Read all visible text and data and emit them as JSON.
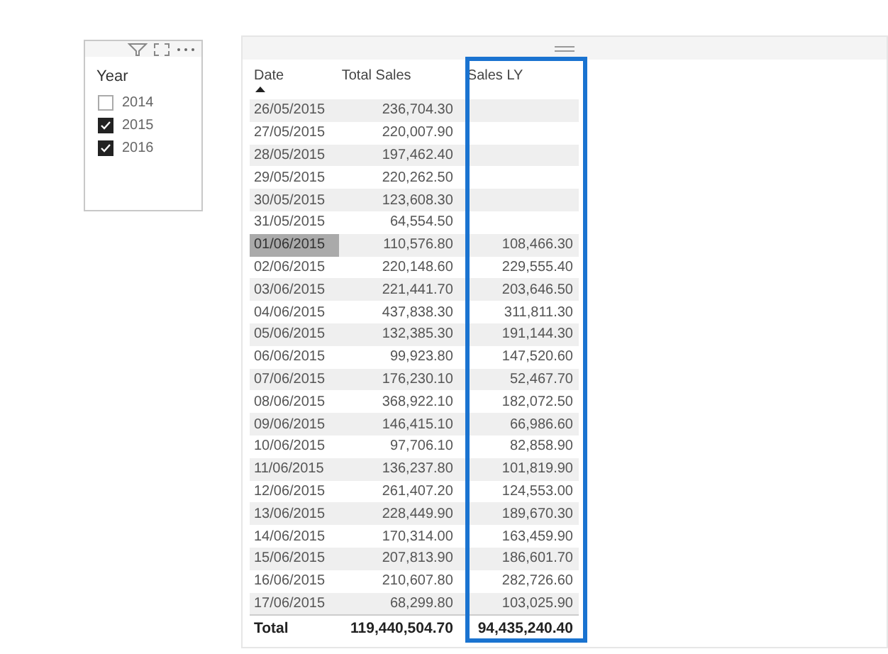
{
  "slicer": {
    "title": "Year",
    "items": [
      {
        "label": "2014",
        "checked": false
      },
      {
        "label": "2015",
        "checked": true
      },
      {
        "label": "2016",
        "checked": true
      }
    ]
  },
  "table": {
    "columns": [
      {
        "label": "Date",
        "highlighted": false
      },
      {
        "label": "Total Sales",
        "highlighted": false
      },
      {
        "label": "Sales LY",
        "highlighted": true
      }
    ],
    "rows": [
      {
        "cells": [
          "26/05/2015",
          "236,704.30",
          ""
        ],
        "selected": false
      },
      {
        "cells": [
          "27/05/2015",
          "220,007.90",
          ""
        ],
        "selected": false
      },
      {
        "cells": [
          "28/05/2015",
          "197,462.40",
          ""
        ],
        "selected": false
      },
      {
        "cells": [
          "29/05/2015",
          "220,262.50",
          ""
        ],
        "selected": false
      },
      {
        "cells": [
          "30/05/2015",
          "123,608.30",
          ""
        ],
        "selected": false
      },
      {
        "cells": [
          "31/05/2015",
          "64,554.50",
          ""
        ],
        "selected": false
      },
      {
        "cells": [
          "01/06/2015",
          "110,576.80",
          "108,466.30"
        ],
        "selected": true
      },
      {
        "cells": [
          "02/06/2015",
          "220,148.60",
          "229,555.40"
        ],
        "selected": false
      },
      {
        "cells": [
          "03/06/2015",
          "221,441.70",
          "203,646.50"
        ],
        "selected": false
      },
      {
        "cells": [
          "04/06/2015",
          "437,838.30",
          "311,811.30"
        ],
        "selected": false
      },
      {
        "cells": [
          "05/06/2015",
          "132,385.30",
          "191,144.30"
        ],
        "selected": false
      },
      {
        "cells": [
          "06/06/2015",
          "99,923.80",
          "147,520.60"
        ],
        "selected": false
      },
      {
        "cells": [
          "07/06/2015",
          "176,230.10",
          "52,467.70"
        ],
        "selected": false
      },
      {
        "cells": [
          "08/06/2015",
          "368,922.10",
          "182,072.50"
        ],
        "selected": false
      },
      {
        "cells": [
          "09/06/2015",
          "146,415.10",
          "66,986.60"
        ],
        "selected": false
      },
      {
        "cells": [
          "10/06/2015",
          "97,706.10",
          "82,858.90"
        ],
        "selected": false
      },
      {
        "cells": [
          "11/06/2015",
          "136,237.80",
          "101,819.90"
        ],
        "selected": false
      },
      {
        "cells": [
          "12/06/2015",
          "261,407.20",
          "124,553.00"
        ],
        "selected": false
      },
      {
        "cells": [
          "13/06/2015",
          "228,449.90",
          "189,670.30"
        ],
        "selected": false
      },
      {
        "cells": [
          "14/06/2015",
          "170,314.00",
          "163,459.90"
        ],
        "selected": false
      },
      {
        "cells": [
          "15/06/2015",
          "207,813.90",
          "186,601.70"
        ],
        "selected": false
      },
      {
        "cells": [
          "16/06/2015",
          "210,607.80",
          "282,726.60"
        ],
        "selected": false
      },
      {
        "cells": [
          "17/06/2015",
          "68,299.80",
          "103,025.90"
        ],
        "selected": false
      }
    ],
    "total": [
      "Total",
      "119,440,504.70",
      "94,435,240.40"
    ]
  }
}
